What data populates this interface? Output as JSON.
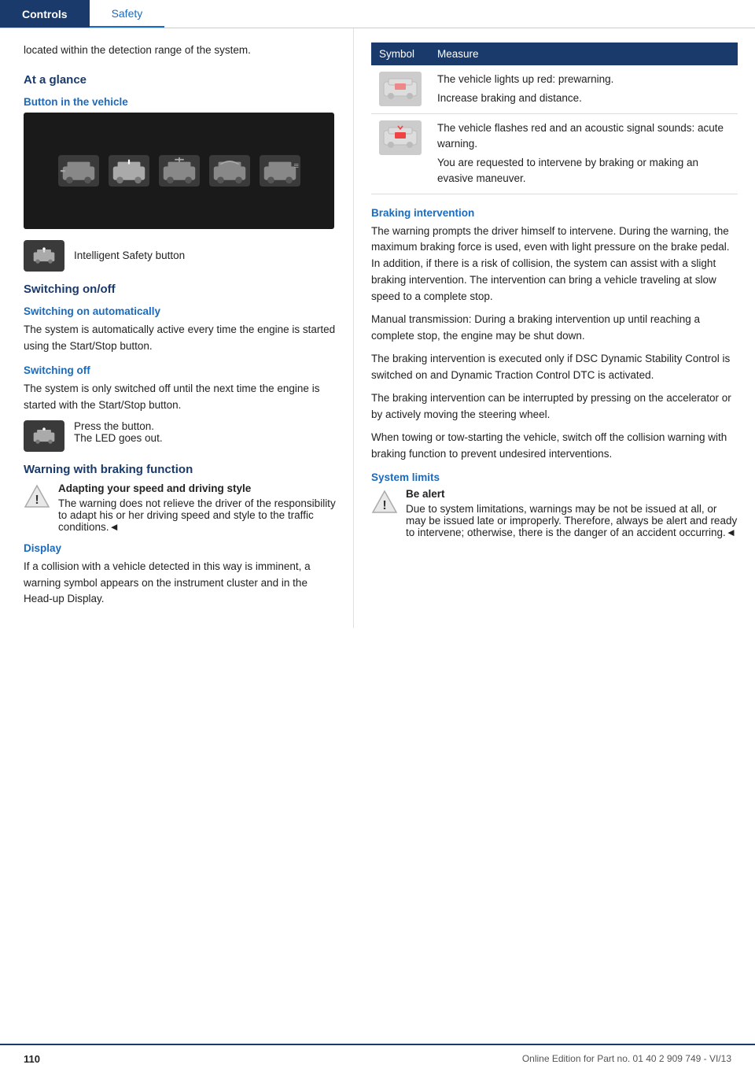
{
  "header": {
    "tab_controls": "Controls",
    "tab_safety": "Safety"
  },
  "left": {
    "intro_text": "located within the detection range of the system.",
    "at_a_glance_heading": "At a glance",
    "button_in_vehicle_heading": "Button in the vehicle",
    "intelligent_safety_label": "Intelligent Safety button",
    "switching_on_off_heading": "Switching on/off",
    "switching_on_auto_heading": "Switching on automatically",
    "switching_on_auto_text": "The system is automatically active every time the engine is started using the Start/Stop button.",
    "switching_off_heading": "Switching off",
    "switching_off_text": "The system is only switched off until the next time the engine is started with the Start/Stop button.",
    "press_button_label": "Press the button.",
    "led_goes_out_label": "The LED goes out.",
    "warning_braking_heading": "Warning with braking function",
    "warning_braking_text1": "Adapting your speed and driving style",
    "warning_braking_text2": "The warning does not relieve the driver of the responsibility to adapt his or her driving speed and style to the traffic conditions.",
    "warning_braking_end": "◄",
    "display_heading": "Display",
    "display_text": "If a collision with a vehicle detected in this way is imminent, a warning symbol appears on the instrument cluster and in the Head-up Display."
  },
  "right": {
    "table_header_symbol": "Symbol",
    "table_header_measure": "Measure",
    "table_rows": [
      {
        "measure_line1": "The vehicle lights up red: prewarning.",
        "measure_line2": "Increase braking and distance."
      },
      {
        "measure_line1": "The vehicle flashes red and an acoustic signal sounds: acute warning.",
        "measure_line2": "You are requested to intervene by braking or making an evasive maneuver."
      }
    ],
    "braking_intervention_heading": "Braking intervention",
    "braking_text1": "The warning prompts the driver himself to intervene. During the warning, the maximum braking force is used, even with light pressure on the brake pedal. In addition, if there is a risk of collision, the system can assist with a slight braking intervention. The intervention can bring a vehicle traveling at slow speed to a complete stop.",
    "braking_text2": "Manual transmission: During a braking intervention up until reaching a complete stop, the engine may be shut down.",
    "braking_text3": "The braking intervention is executed only if DSC Dynamic Stability Control is switched on and Dynamic Traction Control DTC is activated.",
    "braking_text4": "The braking intervention can be interrupted by pressing on the accelerator or by actively moving the steering wheel.",
    "braking_text5": "When towing or tow-starting the vehicle, switch off the collision warning with braking function to prevent undesired interventions.",
    "system_limits_heading": "System limits",
    "system_limits_icon_label": "Be alert",
    "system_limits_text": "Due to system limitations, warnings may be not be issued at all, or may be issued late or improperly. Therefore, always be alert and ready to intervene; otherwise, there is the danger of an accident occurring.",
    "system_limits_end": "◄"
  },
  "footer": {
    "page_number": "110",
    "part_info": "Online Edition for Part no. 01 40 2 909 749 - VI/13"
  }
}
